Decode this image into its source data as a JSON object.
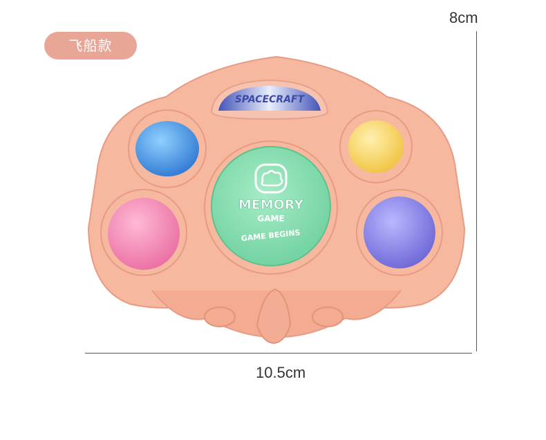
{
  "variant_badge": "飞船款",
  "dimensions": {
    "height": "8cm",
    "width": "10.5cm"
  },
  "toy": {
    "panel_label": "SPACECRAFT",
    "center_button": {
      "line1": "MEMORY",
      "line2": "GAME",
      "line3": "GAME BEGINS"
    }
  },
  "colors": {
    "shell": "#f7b8a0",
    "shell_shadow": "#e89a82",
    "blue": "#3e8fe0",
    "yellow": "#f6d35e",
    "pink": "#f07aaa",
    "purple": "#7a78e0",
    "green": "#7fd9ab"
  }
}
